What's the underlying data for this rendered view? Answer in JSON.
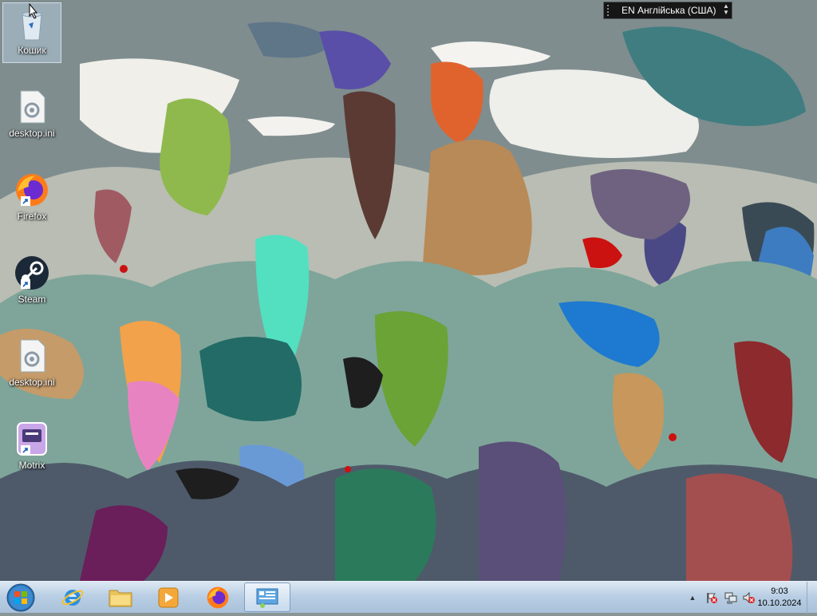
{
  "desktop": {
    "icons": [
      {
        "label": "Кошик",
        "icon": "recycle-bin-icon"
      },
      {
        "label": "desktop.ini",
        "icon": "settings-file-icon"
      },
      {
        "label": "Firefox",
        "icon": "firefox-icon"
      },
      {
        "label": "Steam",
        "icon": "steam-icon"
      },
      {
        "label": "desktop.ini",
        "icon": "settings-file-icon"
      },
      {
        "label": "Motrix",
        "icon": "motrix-icon"
      }
    ]
  },
  "language_bar": {
    "text": "EN Англійська (США)"
  },
  "taskbar": {
    "pinned": [
      {
        "name": "internet-explorer",
        "icon": "ie-icon"
      },
      {
        "name": "file-explorer",
        "icon": "folder-icon"
      },
      {
        "name": "media-player",
        "icon": "media-player-icon"
      },
      {
        "name": "firefox",
        "icon": "firefox-icon"
      },
      {
        "name": "control-panel",
        "icon": "control-panel-icon"
      }
    ],
    "clock_time": "9:03",
    "clock_date": "10.10.2024"
  },
  "colors": {
    "taskbar": "#b7cde3",
    "selection": "#bed7eb"
  }
}
